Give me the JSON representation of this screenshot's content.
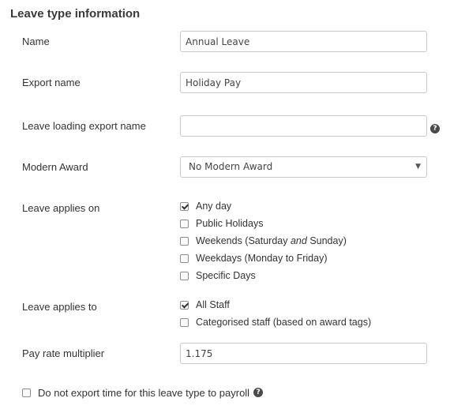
{
  "section": {
    "title": "Leave type information"
  },
  "name": {
    "label": "Name",
    "value": "Annual Leave"
  },
  "export_name": {
    "label": "Export name",
    "value": "Holiday Pay"
  },
  "leave_loading_export_name": {
    "label": "Leave loading export name",
    "value": "",
    "help_icon": "?"
  },
  "modern_award": {
    "label": "Modern Award",
    "selected": "No Modern Award",
    "arrow": "▼"
  },
  "applies_on": {
    "label": "Leave applies on",
    "options": [
      {
        "label": "Any day",
        "checked": true
      },
      {
        "label": "Public Holidays",
        "checked": false
      },
      {
        "label_before": "Weekends (Saturday ",
        "label_em": "and",
        "label_after": " Sunday)",
        "checked": false
      },
      {
        "label": "Weekdays (Monday to Friday)",
        "checked": false
      },
      {
        "label": "Specific Days",
        "checked": false
      }
    ]
  },
  "applies_to": {
    "label": "Leave applies to",
    "options": [
      {
        "label": "All Staff",
        "checked": true
      },
      {
        "label": "Categorised staff (based on award tags)",
        "checked": false
      }
    ]
  },
  "pay_rate_multiplier": {
    "label": "Pay rate multiplier",
    "value": "1.175"
  },
  "do_not_export": {
    "label": "Do not export time for this leave type to payroll",
    "checked": false,
    "help_icon": "?"
  }
}
